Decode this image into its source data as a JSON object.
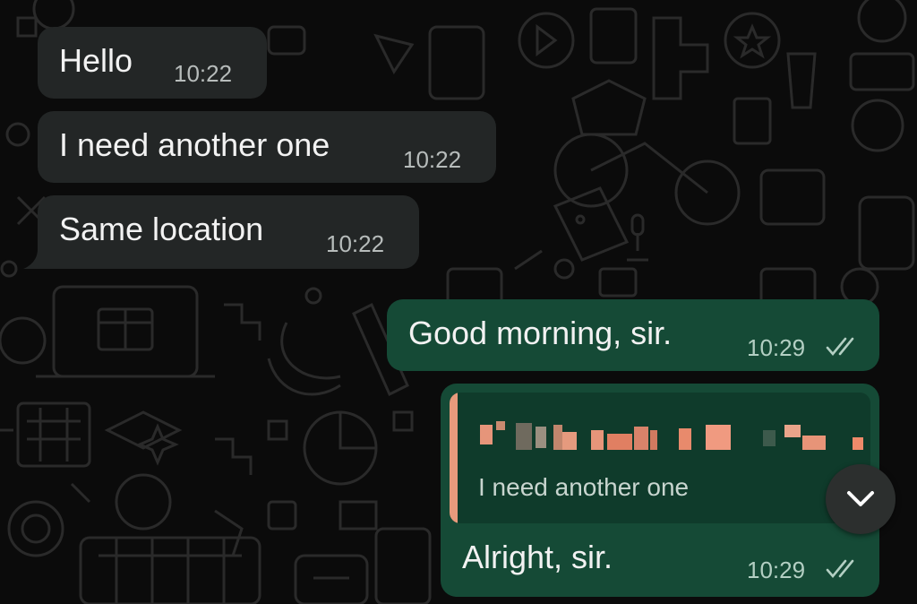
{
  "messages": [
    {
      "id": "m1",
      "direction": "incoming",
      "text": "Hello",
      "time": "10:22"
    },
    {
      "id": "m2",
      "direction": "incoming",
      "text": "I need another one",
      "time": "10:22"
    },
    {
      "id": "m3",
      "direction": "incoming",
      "text": "Same location",
      "time": "10:22"
    },
    {
      "id": "m4",
      "direction": "outgoing",
      "text": "Good morning, sir.",
      "time": "10:29",
      "status": "read-double-check"
    },
    {
      "id": "m5",
      "direction": "outgoing",
      "text": "Alright, sir.",
      "time": "10:29",
      "status": "read-double-check",
      "reply_to": {
        "author": "[redacted]",
        "text": "I need another one"
      }
    }
  ],
  "scroll_button": {
    "icon": "chevron-down-icon"
  },
  "colors": {
    "background": "#0b0b0b",
    "incoming_bubble": "#232626",
    "outgoing_bubble": "#154a36",
    "quote_bar": "#e89a7c"
  }
}
